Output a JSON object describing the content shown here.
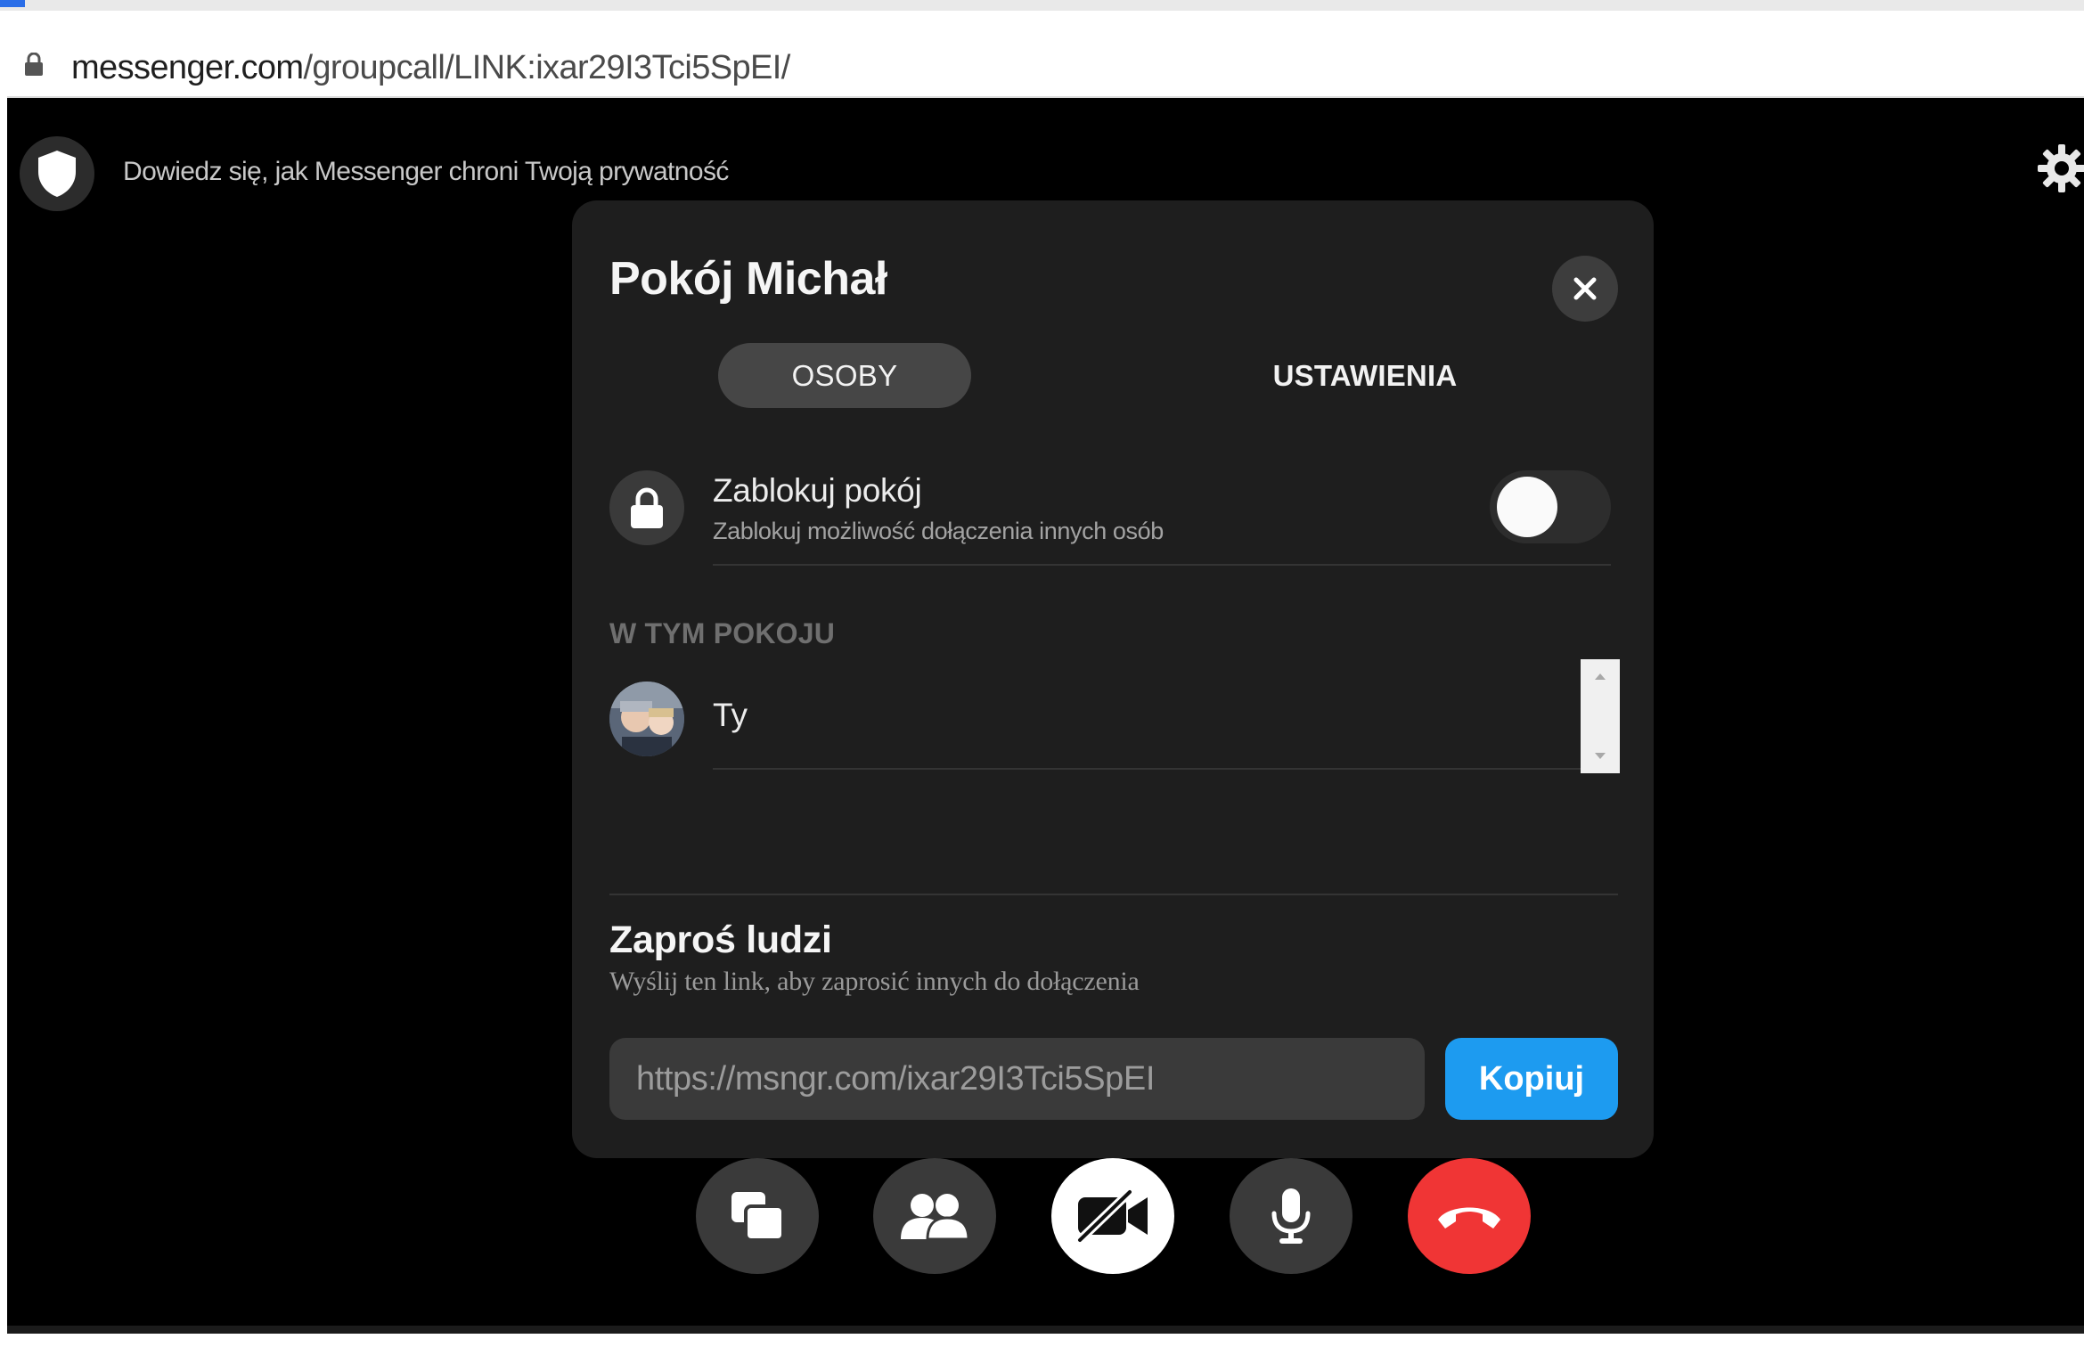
{
  "browser": {
    "url_host": "messenger.com",
    "url_path": "/groupcall/LINK:ixar29I3Tci5SpEI/"
  },
  "call": {
    "privacy_text": "Dowiedz się, jak Messenger chroni Twoją prywatność",
    "icons": [
      "shield-icon",
      "gear-icon"
    ]
  },
  "modal": {
    "title": "Pokój Michał",
    "tabs": [
      {
        "label": "OSOBY",
        "active": true
      },
      {
        "label": "USTAWIENIA",
        "active": false
      }
    ],
    "lock": {
      "title": "Zablokuj pokój",
      "subtitle": "Zablokuj możliwość dołączenia innych osób",
      "enabled": false
    },
    "in_room_header": "W TYM POKOJU",
    "participants": [
      {
        "name": "Ty"
      }
    ],
    "invite": {
      "title": "Zaproś ludzi",
      "subtitle": "Wyślij ten link, aby zaprosić innych do dołączenia",
      "link": "https://msngr.com/ixar29I3Tci5SpEI",
      "copy_label": "Kopiuj"
    }
  },
  "controls": [
    {
      "icon": "share-screen-icon"
    },
    {
      "icon": "people-icon"
    },
    {
      "icon": "camera-off-icon"
    },
    {
      "icon": "microphone-icon"
    },
    {
      "icon": "hang-up-icon"
    }
  ],
  "colors": {
    "accent_blue": "#1d9bf0",
    "hangup_red": "#f03535",
    "modal_bg": "#1e1e1e"
  }
}
